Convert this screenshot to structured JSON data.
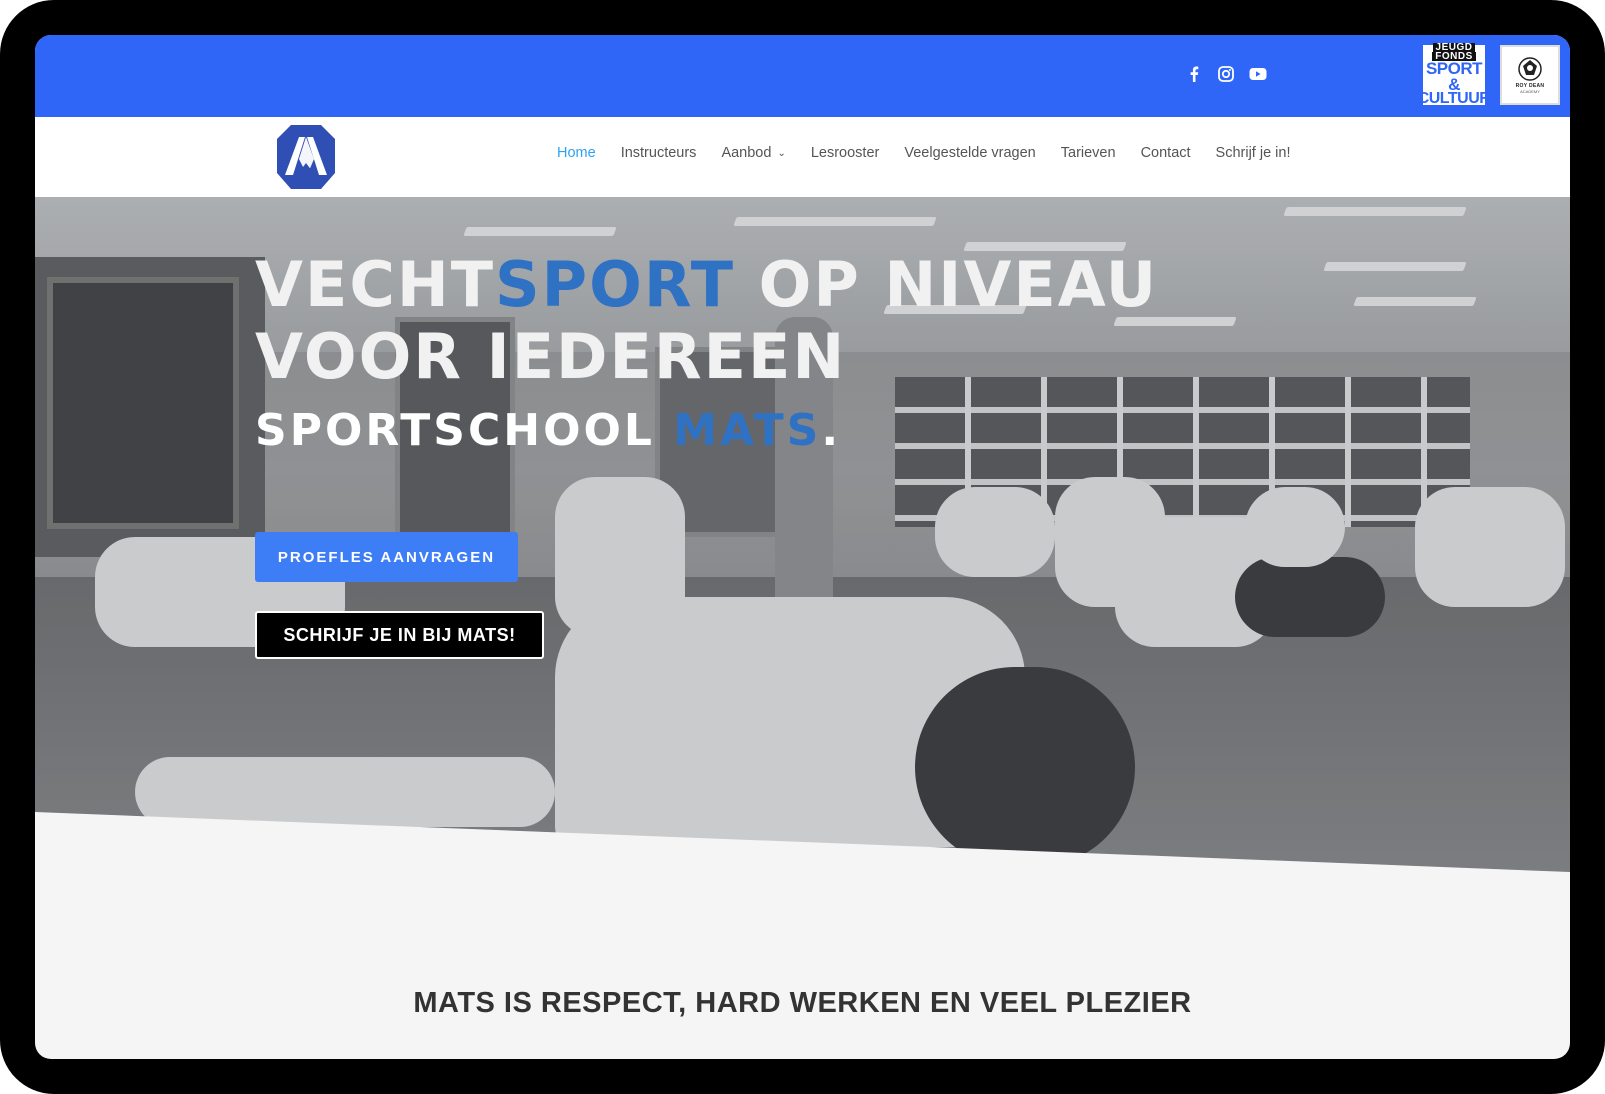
{
  "header": {
    "social_icons": [
      "facebook-icon",
      "instagram-icon",
      "youtube-icon"
    ],
    "badge_jeugdfonds": {
      "line1": "JEUGD",
      "line2": "FONDS",
      "line3": "SPORT &",
      "line4": "CULTUUR"
    },
    "badge_academy": {
      "line1": "ROY DEAN",
      "line2": "ACADEMY"
    }
  },
  "nav": {
    "items": [
      {
        "label": "Home",
        "active": true
      },
      {
        "label": "Instructeurs"
      },
      {
        "label": "Aanbod",
        "has_dropdown": true
      },
      {
        "label": "Lesrooster"
      },
      {
        "label": "Veelgestelde vragen"
      },
      {
        "label": "Tarieven"
      },
      {
        "label": "Contact"
      },
      {
        "label": "Schrijf je in!"
      }
    ]
  },
  "hero": {
    "title_part1": "VECHT",
    "title_part2": "SPORT",
    "title_part3": " OP NIVEAU",
    "title_line2": "VOOR IEDEREEN",
    "subtitle_part1": "SPORTSCHOOL ",
    "subtitle_part2": "MATS",
    "subtitle_part3": ".",
    "button_trial": "PROEFLES AANVRAGEN",
    "button_signup": "SCHRIJF JE IN BIJ MATS!"
  },
  "section": {
    "tagline": "MATS IS RESPECT, HARD WERKEN EN VEEL PLEZIER"
  },
  "colors": {
    "topbar": "#2f66f7",
    "nav_active": "#2ea3f2",
    "accent_text": "#2f72c4",
    "button_blue": "#3d7df5"
  }
}
